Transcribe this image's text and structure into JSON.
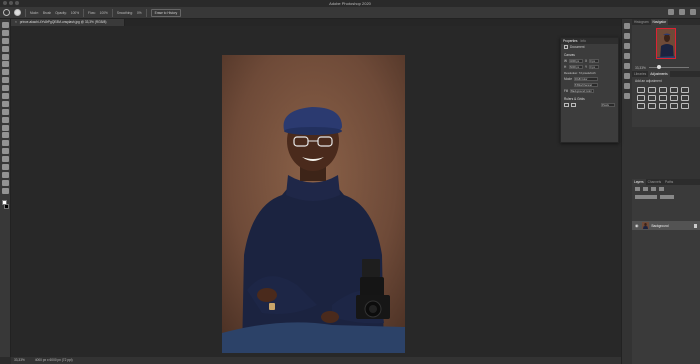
{
  "app": {
    "title": "Adobe Photoshop 2020"
  },
  "options": {
    "mode_label": "Mode:",
    "mode_value": "Brush",
    "opacity_label": "Opacity:",
    "opacity_value": "100%",
    "flow_label": "Flow:",
    "flow_value": "100%",
    "smoothing_label": "Smoothing:",
    "smoothing_value": "0%",
    "erase_button": "Erase to History"
  },
  "document": {
    "tab_label": "prince-akachi-4Yv8rPgQE8M-unsplash.jpg @ 33,3% (RGB/8)",
    "zoom": "33,33%",
    "doc_info": "4000 px x 6000 px (72 ppi)"
  },
  "navigator_panel": {
    "tabs": [
      "Histogram",
      "Navigator"
    ],
    "active_tab": "Navigator",
    "zoom": "33,33%"
  },
  "adjustments_panel": {
    "tabs": [
      "Libraries",
      "Adjustments"
    ],
    "active_tab": "Adjustments",
    "heading": "Add an adjustment"
  },
  "layers_panel": {
    "tabs": [
      "Layers",
      "Channels",
      "Paths"
    ],
    "active_tab": "Layers",
    "layers": [
      {
        "name": "Background",
        "visible": true,
        "locked": true
      }
    ]
  },
  "properties_panel": {
    "tabs": [
      "Properties",
      "Info"
    ],
    "active_tab": "Properties",
    "doc_label": "Document",
    "canvas_label": "Canvas",
    "width_value": "4000 px",
    "height_value": "6000 px",
    "x_value": "0 px",
    "y_value": "0 px",
    "resolution": "Resolution: 72 pixels/inch",
    "mode_label": "Mode",
    "mode_value": "RGB Color",
    "bit_value": "8 Bits/Channel",
    "fill_label": "Fill",
    "fill_value": "Background Color",
    "rulers_label": "Rulers & Grids",
    "units_value": "Pixels"
  },
  "colors": {
    "ui_bg": "#282828",
    "panel_bg": "#3a3a3a",
    "photo_bg": "#6e4a38"
  }
}
